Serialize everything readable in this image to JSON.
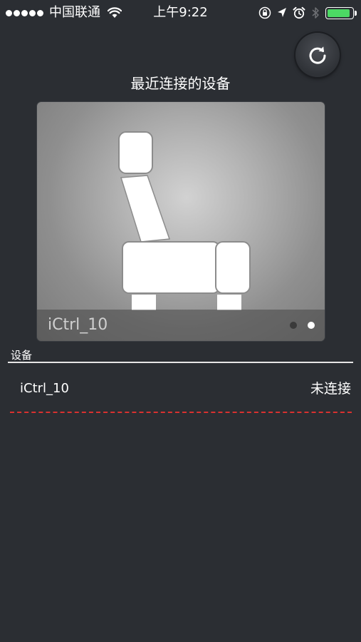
{
  "status_bar": {
    "carrier": "中国联通",
    "time": "上午9:22",
    "signal_bars": 5,
    "battery_level": 0.9,
    "icons": [
      "wifi-icon",
      "orientation-lock-icon",
      "location-icon",
      "alarm-icon",
      "bluetooth-icon",
      "battery-icon"
    ],
    "battery_color": "#4cd964"
  },
  "toolbar": {
    "refresh_icon": "refresh-icon"
  },
  "recent": {
    "title": "最近连接的设备",
    "card": {
      "device_name": "iCtrl_10",
      "image_icon": "seat-icon",
      "page_count": 2,
      "current_page": 2
    }
  },
  "devices": {
    "header": "设备",
    "items": [
      {
        "name": "iCtrl_10",
        "status": "未连接"
      }
    ],
    "divider_color": "#d9312f"
  },
  "colors": {
    "background": "#2b2e33",
    "text": "#ffffff"
  }
}
